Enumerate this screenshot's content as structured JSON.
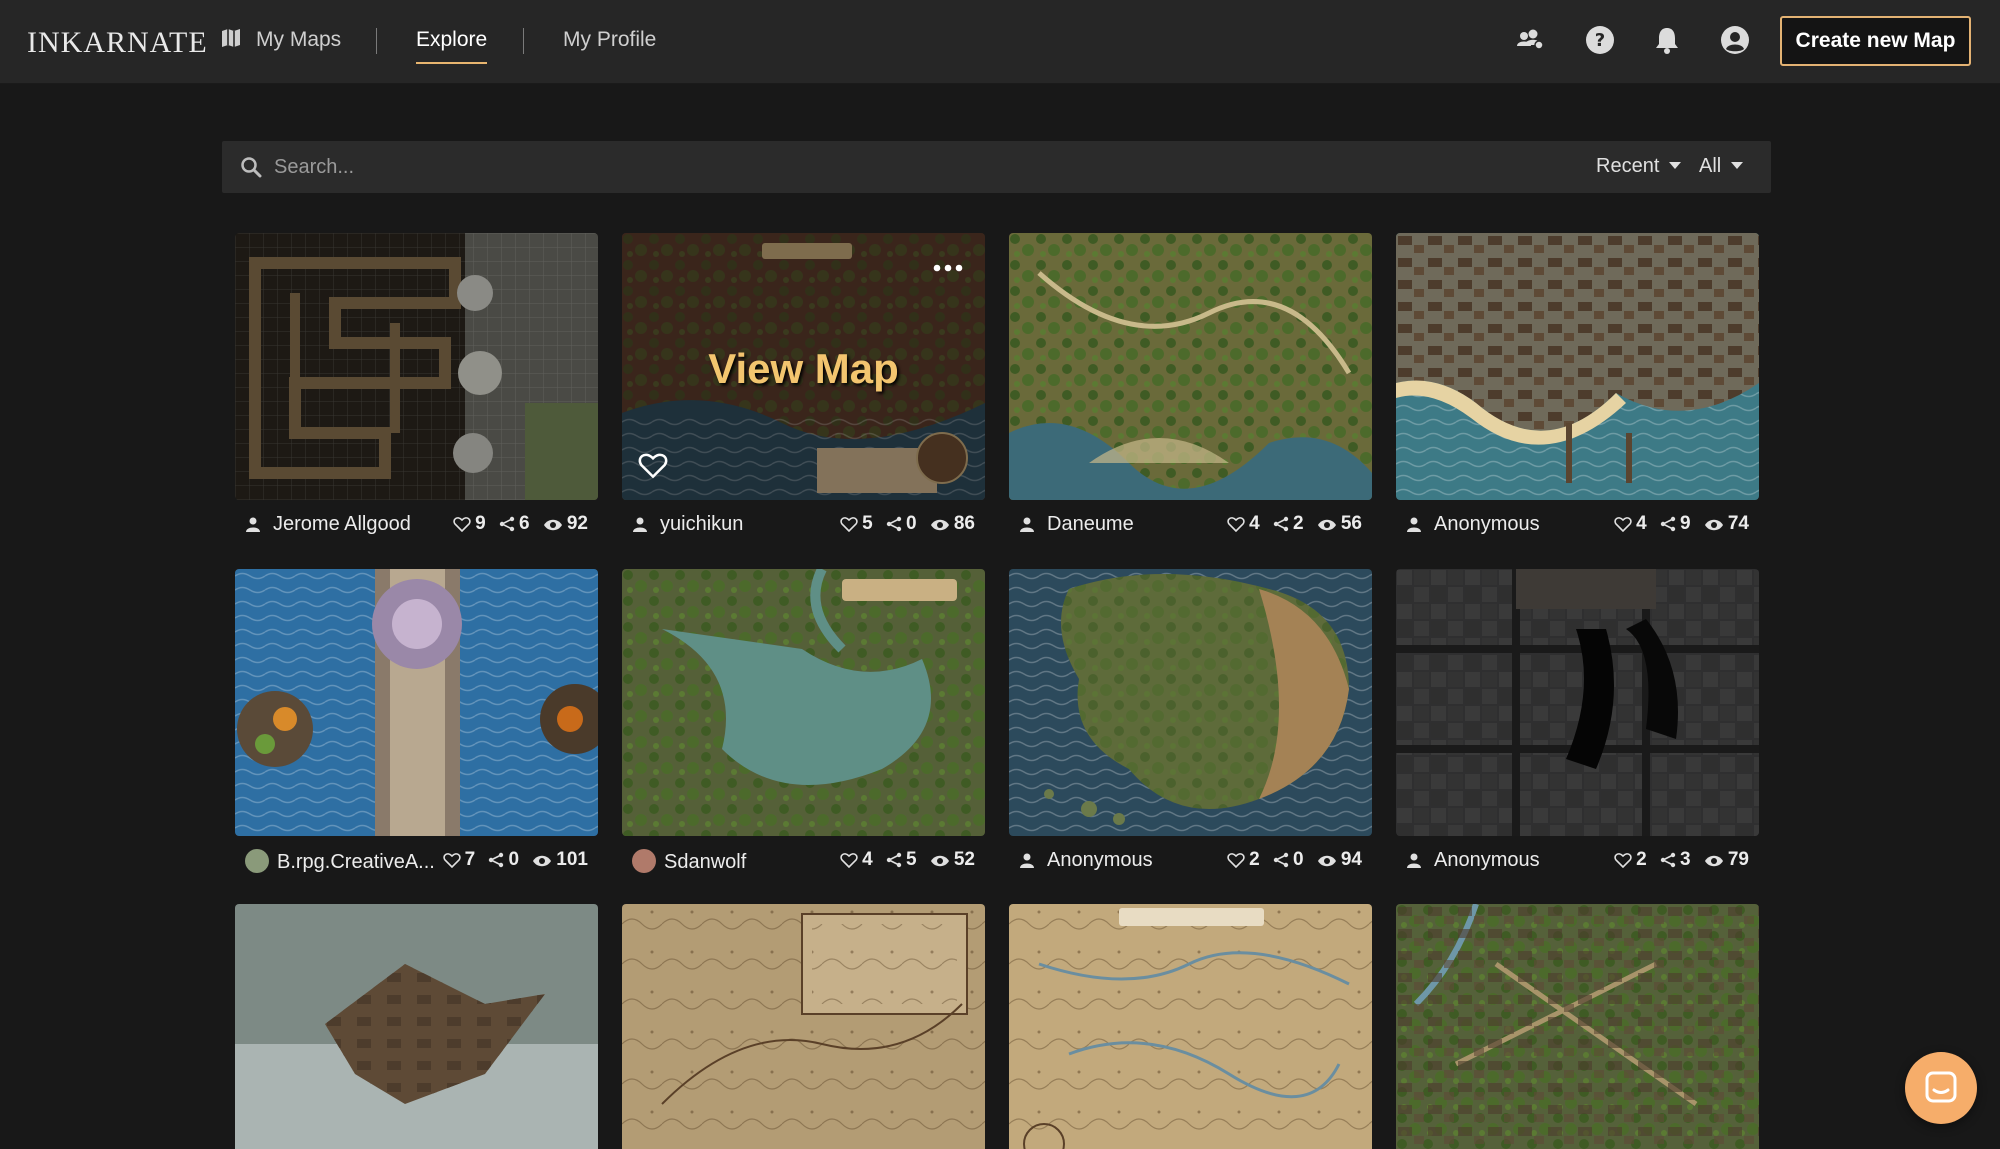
{
  "app": {
    "logo": "INKARNATE",
    "nav": {
      "my_maps": "My Maps",
      "explore": "Explore",
      "my_profile": "My Profile"
    },
    "create_button": "Create new Map"
  },
  "search": {
    "placeholder": "Search...",
    "sort_selected": "Recent",
    "filter_selected": "All"
  },
  "hover": {
    "view_map": "View Map"
  },
  "maps": [
    {
      "author": "Jerome Allgood",
      "likes": "9",
      "shares": "6",
      "views": "92"
    },
    {
      "author": "yuichikun",
      "likes": "5",
      "shares": "0",
      "views": "86"
    },
    {
      "author": "Daneume",
      "likes": "4",
      "shares": "2",
      "views": "56"
    },
    {
      "author": "Anonymous",
      "likes": "4",
      "shares": "9",
      "views": "74"
    },
    {
      "author": "B.rpg.CreativeA...",
      "likes": "7",
      "shares": "0",
      "views": "101"
    },
    {
      "author": "Sdanwolf",
      "likes": "4",
      "shares": "5",
      "views": "52"
    },
    {
      "author": "Anonymous",
      "likes": "2",
      "shares": "0",
      "views": "94"
    },
    {
      "author": "Anonymous",
      "likes": "2",
      "shares": "3",
      "views": "79"
    },
    {
      "author": "",
      "likes": "",
      "shares": "",
      "views": ""
    },
    {
      "author": "",
      "likes": "",
      "shares": "",
      "views": ""
    },
    {
      "author": "",
      "likes": "",
      "shares": "",
      "views": ""
    },
    {
      "author": "",
      "likes": "",
      "shares": "",
      "views": ""
    }
  ],
  "colors": {
    "accent": "#e3b273",
    "topbar": "#262626",
    "background": "#181818",
    "chat": "#f6ad6a"
  },
  "icons": [
    "map-icon",
    "community-icon",
    "help-icon",
    "bell-icon",
    "account-icon",
    "search-icon",
    "user-icon",
    "heart-icon",
    "share-icon",
    "eye-icon",
    "more-icon",
    "chat-icon"
  ]
}
